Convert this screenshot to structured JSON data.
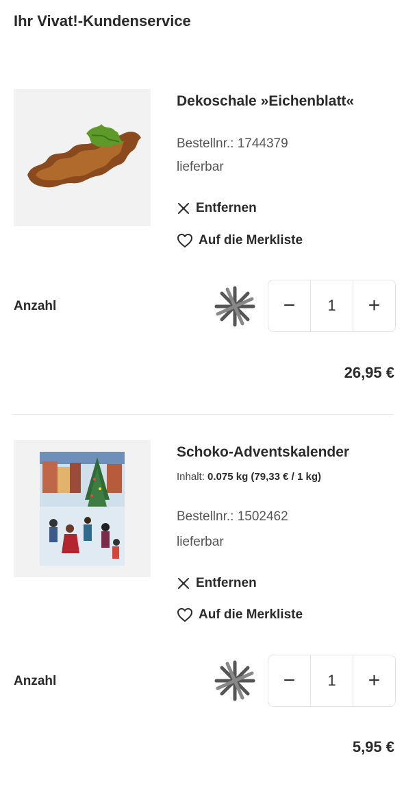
{
  "header": {
    "title": "Ihr Vivat!-Kundenservice"
  },
  "items": [
    {
      "title": "Dekoschale »Eichenblatt«",
      "order_label": "Bestellnr.: 1744379",
      "availability": "lieferbar",
      "remove_label": "Entfernen",
      "wishlist_label": "Auf die Merkliste",
      "quantity_label": "Anzahl",
      "quantity": "1",
      "price": "26,95 €",
      "image_icon": "wooden-leaf-bowl-image"
    },
    {
      "title": "Schoko-Adventskalender",
      "content_label": "Inhalt:",
      "content_value": "0.075 kg (79,33 € / 1 kg)",
      "order_label": "Bestellnr.: 1502462",
      "availability": "lieferbar",
      "remove_label": "Entfernen",
      "wishlist_label": "Auf die Merkliste",
      "quantity_label": "Anzahl",
      "quantity": "1",
      "price": "5,95 €",
      "image_icon": "advent-calendar-image"
    }
  ],
  "stepper": {
    "minus": "−",
    "plus": "+"
  },
  "colors": {
    "text": "#2a2a2a",
    "thumb_bg": "#f2f2f2",
    "border": "#e4e4e4"
  }
}
